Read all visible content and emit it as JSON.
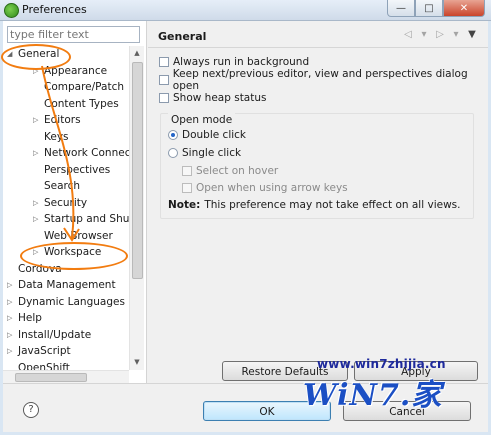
{
  "window": {
    "title": "Preferences",
    "minimize_glyph": "—",
    "maximize_glyph": "□",
    "close_glyph": "✕"
  },
  "filter": {
    "placeholder": "type filter text"
  },
  "tree": [
    {
      "label": "General",
      "level": 0,
      "expanded": true,
      "twisty": "◢"
    },
    {
      "label": "Appearance",
      "level": 1,
      "twisty": "▷"
    },
    {
      "label": "Compare/Patch",
      "level": 1
    },
    {
      "label": "Content Types",
      "level": 1
    },
    {
      "label": "Editors",
      "level": 1,
      "twisty": "▷"
    },
    {
      "label": "Keys",
      "level": 1
    },
    {
      "label": "Network Connection",
      "level": 1,
      "twisty": "▷"
    },
    {
      "label": "Perspectives",
      "level": 1
    },
    {
      "label": "Search",
      "level": 1
    },
    {
      "label": "Security",
      "level": 1,
      "twisty": "▷"
    },
    {
      "label": "Startup and Shutdown",
      "level": 1,
      "twisty": "▷"
    },
    {
      "label": "Web Browser",
      "level": 1
    },
    {
      "label": "Workspace",
      "level": 1,
      "twisty": "▷"
    },
    {
      "label": "Cordova",
      "level": 0
    },
    {
      "label": "Data Management",
      "level": 0,
      "twisty": "▷"
    },
    {
      "label": "Dynamic Languages",
      "level": 0,
      "twisty": "▷"
    },
    {
      "label": "Help",
      "level": 0,
      "twisty": "▷"
    },
    {
      "label": "Install/Update",
      "level": 0,
      "twisty": "▷"
    },
    {
      "label": "JavaScript",
      "level": 0,
      "twisty": "▷"
    },
    {
      "label": "OpenShift",
      "level": 0
    }
  ],
  "page": {
    "title": "General",
    "options": {
      "always_run_bg": "Always run in background",
      "keep_next_prev": "Keep next/previous editor, view and perspectives dialog open",
      "show_heap": "Show heap status"
    },
    "open_mode": {
      "label": "Open mode",
      "double_click": "Double click",
      "single_click": "Single click",
      "select_on_hover": "Select on hover",
      "open_arrow_keys": "Open when using arrow keys",
      "selected": "Double click"
    },
    "note_label": "Note:",
    "note_text": "This preference may not take effect on all views.",
    "restore_defaults": "Restore Defaults",
    "apply": "Apply"
  },
  "footer": {
    "help": "?",
    "ok": "OK",
    "cancel": "Cancel"
  },
  "watermark": {
    "site": "www.win7zhijia.cn",
    "logo": "WiN7.家"
  },
  "colors": {
    "annotation": "#f27c10",
    "watermark": "#1b4fc4"
  },
  "icons": {
    "nav_back": "◁",
    "nav_back_menu": "▾",
    "nav_forward": "▷",
    "nav_forward_menu": "▾",
    "view_menu": "▼",
    "scroll_up": "▲",
    "scroll_down": "▼"
  }
}
